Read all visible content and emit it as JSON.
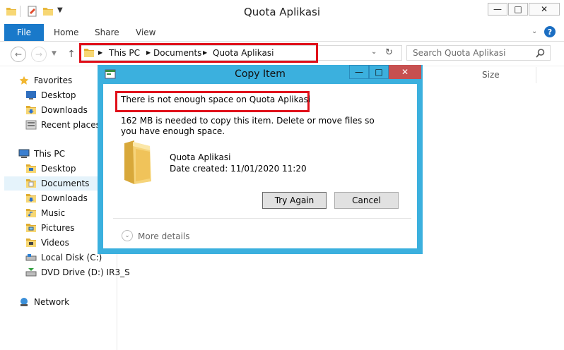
{
  "window": {
    "title": "Quota Aplikasi",
    "minimize": "—",
    "maximize": "□",
    "close": "✕",
    "help": "?"
  },
  "ribbon": {
    "file": "File",
    "tabs": [
      "Home",
      "Share",
      "View"
    ]
  },
  "address": {
    "crumbs": [
      "This PC",
      "Documents",
      "Quota Aplikasi"
    ],
    "search_placeholder": "Search Quota Aplikasi"
  },
  "nav": {
    "favorites": {
      "label": "Favorites",
      "items": [
        "Desktop",
        "Downloads",
        "Recent places"
      ]
    },
    "this_pc": {
      "label": "This PC",
      "items": [
        "Desktop",
        "Documents",
        "Downloads",
        "Music",
        "Pictures",
        "Videos",
        "Local Disk (C:)",
        "DVD Drive (D:) IR3_S"
      ],
      "selected": "Documents"
    },
    "network": "Network"
  },
  "columns": {
    "size": "Size"
  },
  "dialog": {
    "title": "Copy Item",
    "headline": "There is not enough space on Quota Aplikasi",
    "detail": "162 MB is needed to copy this item. Delete or move files so you have enough space.",
    "item_name": "Quota Aplikasi",
    "item_date": "Date created: 11/01/2020 11:20",
    "try_again": "Try Again",
    "cancel": "Cancel",
    "more_details": "More details",
    "minimize": "—",
    "maximize": "□",
    "close": "✕"
  },
  "colors": {
    "accent": "#1979ca",
    "dialog_frame": "#3bb0de",
    "highlight": "#e0101a",
    "close_button": "#c75050"
  }
}
